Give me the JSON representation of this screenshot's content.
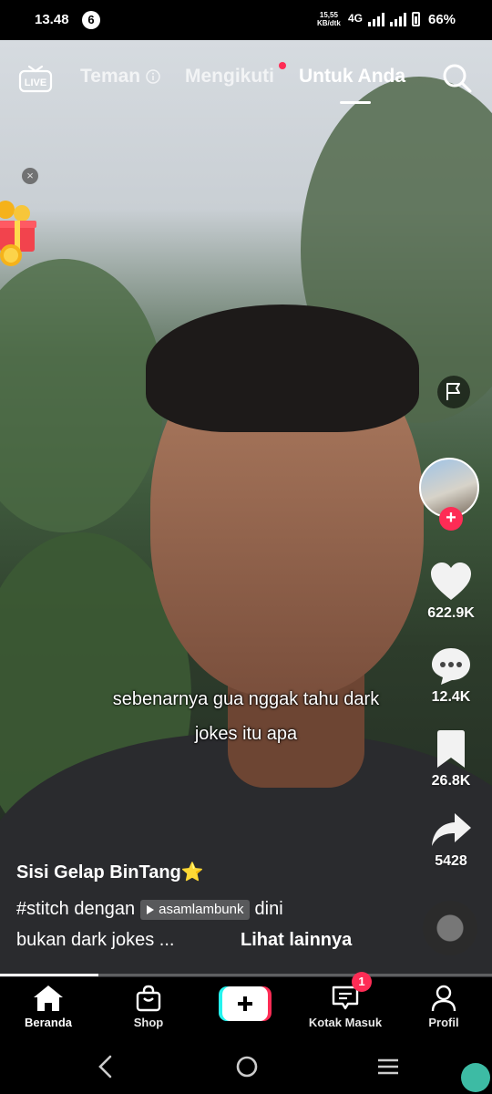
{
  "status_bar": {
    "time": "13.48",
    "notification_count": "6",
    "speed_value": "15,55",
    "speed_unit": "KB/dtk",
    "network": "4G",
    "battery": "66%"
  },
  "top_nav": {
    "tabs": [
      {
        "label": "Teman"
      },
      {
        "label": "Mengikuti"
      },
      {
        "label": "Untuk Anda"
      }
    ],
    "active_tab": "Untuk Anda",
    "live_label": "LIVE"
  },
  "gift": {
    "close_label": "×"
  },
  "actions": {
    "likes": "622.9K",
    "comments": "12.4K",
    "saves": "26.8K",
    "shares": "5428"
  },
  "video": {
    "caption_line1": "sebenarnya gua nggak tahu dark",
    "caption_line2": "jokes itu apa",
    "progress": 0.2
  },
  "post": {
    "username": "Sisi Gelap BinTang",
    "username_emoji": "⭐",
    "desc_prefix": "#stitch dengan",
    "stitch_user": "asamlambunk",
    "desc_suffix": "dini",
    "desc_line2": "bukan dark jokes ...",
    "see_more": "Lihat lainnya"
  },
  "bottom_nav": {
    "home": "Beranda",
    "shop": "Shop",
    "inbox": "Kotak Masuk",
    "inbox_badge": "1",
    "profile": "Profil"
  },
  "colors": {
    "accent": "#fe2c55",
    "cyan": "#25f4ee"
  }
}
